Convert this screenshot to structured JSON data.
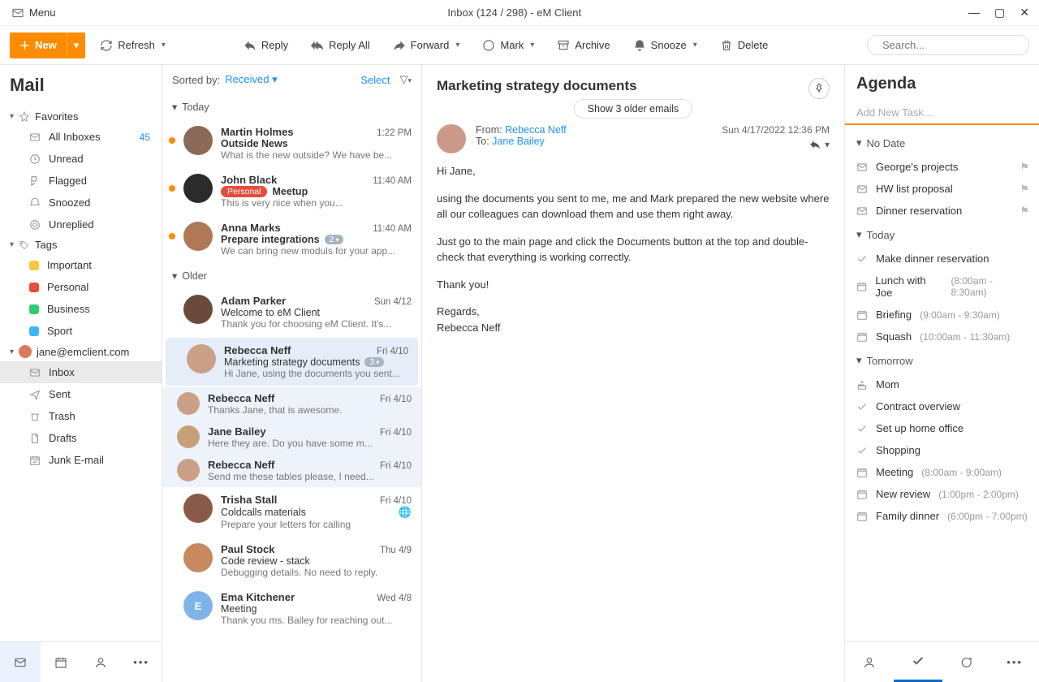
{
  "window": {
    "menu": "Menu",
    "title": "Inbox (124 / 298) - eM Client"
  },
  "toolbar": {
    "new": "New",
    "refresh": "Refresh",
    "reply": "Reply",
    "reply_all": "Reply All",
    "forward": "Forward",
    "mark": "Mark",
    "archive": "Archive",
    "snooze": "Snooze",
    "delete": "Delete",
    "search_placeholder": "Search..."
  },
  "nav": {
    "title": "Mail",
    "favorites_label": "Favorites",
    "favorites": [
      {
        "label": "All Inboxes",
        "count": "45"
      },
      {
        "label": "Unread"
      },
      {
        "label": "Flagged"
      },
      {
        "label": "Snoozed"
      },
      {
        "label": "Unreplied"
      }
    ],
    "tags_label": "Tags",
    "tags": [
      {
        "label": "Important",
        "color": "#f4c842"
      },
      {
        "label": "Personal",
        "color": "#e74c3c"
      },
      {
        "label": "Business",
        "color": "#2ecc71"
      },
      {
        "label": "Sport",
        "color": "#3fb6f2"
      }
    ],
    "account": "jane@emclient.com",
    "folders": [
      {
        "label": "Inbox"
      },
      {
        "label": "Sent"
      },
      {
        "label": "Trash"
      },
      {
        "label": "Drafts"
      },
      {
        "label": "Junk E-mail"
      }
    ]
  },
  "list": {
    "sorted_by_label": "Sorted by:",
    "sorted_by_value": "Received",
    "select": "Select",
    "groups": {
      "today": "Today",
      "older": "Older"
    },
    "messages": [
      {
        "sender": "Martin Holmes",
        "subject": "Outside News",
        "preview": "What is the new outside? We have be...",
        "date": "1:22 PM",
        "unread": true,
        "avatar": "#8a6a56"
      },
      {
        "sender": "John Black",
        "subject": "Meetup",
        "preview": "This is very nice when you...",
        "date": "11:40 AM",
        "unread": true,
        "avatar": "#2b2b2b",
        "tag": "Personal"
      },
      {
        "sender": "Anna Marks",
        "subject": "Prepare integrations",
        "preview": "We can bring new moduls for your app...",
        "date": "11:40 AM",
        "unread": true,
        "avatar": "#b07855",
        "badge": "2"
      },
      {
        "sender": "Adam Parker",
        "subject": "Welcome to eM Client",
        "preview": "Thank you for choosing eM Client. It's...",
        "date": "Sun 4/12",
        "avatar": "#6a4a3a"
      },
      {
        "sender": "Rebecca Neff",
        "subject": "Marketing strategy documents",
        "preview": "Hi Jane, using the documents you sent...",
        "date": "Fri 4/10",
        "avatar": "#caa088",
        "badge": "3",
        "thread": true,
        "selected": true
      },
      {
        "sender": "Rebecca Neff",
        "subject": "Thanks Jane, that is awesome.",
        "date": "Fri 4/10",
        "avatar": "#caa088",
        "child": true
      },
      {
        "sender": "Jane Bailey",
        "subject": "Here they are. Do you have some m...",
        "date": "Fri 4/10",
        "avatar": "#c8a078",
        "child": true
      },
      {
        "sender": "Rebecca Neff",
        "subject": "Send me these tables please, I need...",
        "date": "Fri 4/10",
        "avatar": "#caa088",
        "child": true
      },
      {
        "sender": "Trisha Stall",
        "subject": "Coldcalls materials",
        "preview": "Prepare your letters for calling",
        "date": "Fri 4/10",
        "avatar": "#8a5a48",
        "globe": true
      },
      {
        "sender": "Paul Stock",
        "subject": "Code review - stack",
        "preview": "Debugging details. No need to reply.",
        "date": "Thu 4/9",
        "avatar": "#c9895f"
      },
      {
        "sender": "Ema Kitchener",
        "subject": "Meeting",
        "preview": "Thank you ms. Bailey for reaching out...",
        "date": "Wed 4/8",
        "avatar": "#7fb4e8",
        "letter": "E"
      }
    ]
  },
  "reader": {
    "subject": "Marketing strategy documents",
    "older_pill": "Show 3 older emails",
    "from_label": "From:",
    "from": "Rebecca Neff",
    "to_label": "To:",
    "to": "Jane Bailey",
    "date": "Sun 4/17/2022 12:36 PM",
    "body": [
      "Hi Jane,",
      "using the documents you sent to me, me and Mark prepared the new website where all our colleagues can download them and use them right away.",
      "Just go to the main page and click the Documents button at the top and double-check that everything is working correctly.",
      "Thank you!",
      "Regards,\nRebecca Neff"
    ]
  },
  "agenda": {
    "title": "Agenda",
    "add_task": "Add New Task...",
    "groups": [
      {
        "label": "No Date",
        "items": [
          {
            "icon": "mail",
            "text": "George's projects",
            "flag": true
          },
          {
            "icon": "mail",
            "text": "HW list proposal",
            "flag": true
          },
          {
            "icon": "mail",
            "text": "Dinner reservation",
            "flag": true
          }
        ]
      },
      {
        "label": "Today",
        "items": [
          {
            "icon": "check",
            "text": "Make dinner reservation"
          },
          {
            "icon": "cal",
            "text": "Lunch with Joe",
            "time": "(8:00am - 8:30am)"
          },
          {
            "icon": "cal",
            "text": "Briefing",
            "time": "(9:00am - 9:30am)"
          },
          {
            "icon": "cal",
            "text": "Squash",
            "time": "(10:00am - 11:30am)"
          }
        ]
      },
      {
        "label": "Tomorrow",
        "items": [
          {
            "icon": "cake",
            "text": "Mom"
          },
          {
            "icon": "check",
            "text": "Contract overview"
          },
          {
            "icon": "check",
            "text": "Set up home office"
          },
          {
            "icon": "check",
            "text": "Shopping"
          },
          {
            "icon": "cal",
            "text": "Meeting",
            "time": "(8:00am - 9:00am)"
          },
          {
            "icon": "cal",
            "text": "New review",
            "time": "(1:00pm - 2:00pm)"
          },
          {
            "icon": "cal",
            "text": "Family dinner",
            "time": "(6:00pm - 7:00pm)"
          }
        ]
      }
    ]
  }
}
